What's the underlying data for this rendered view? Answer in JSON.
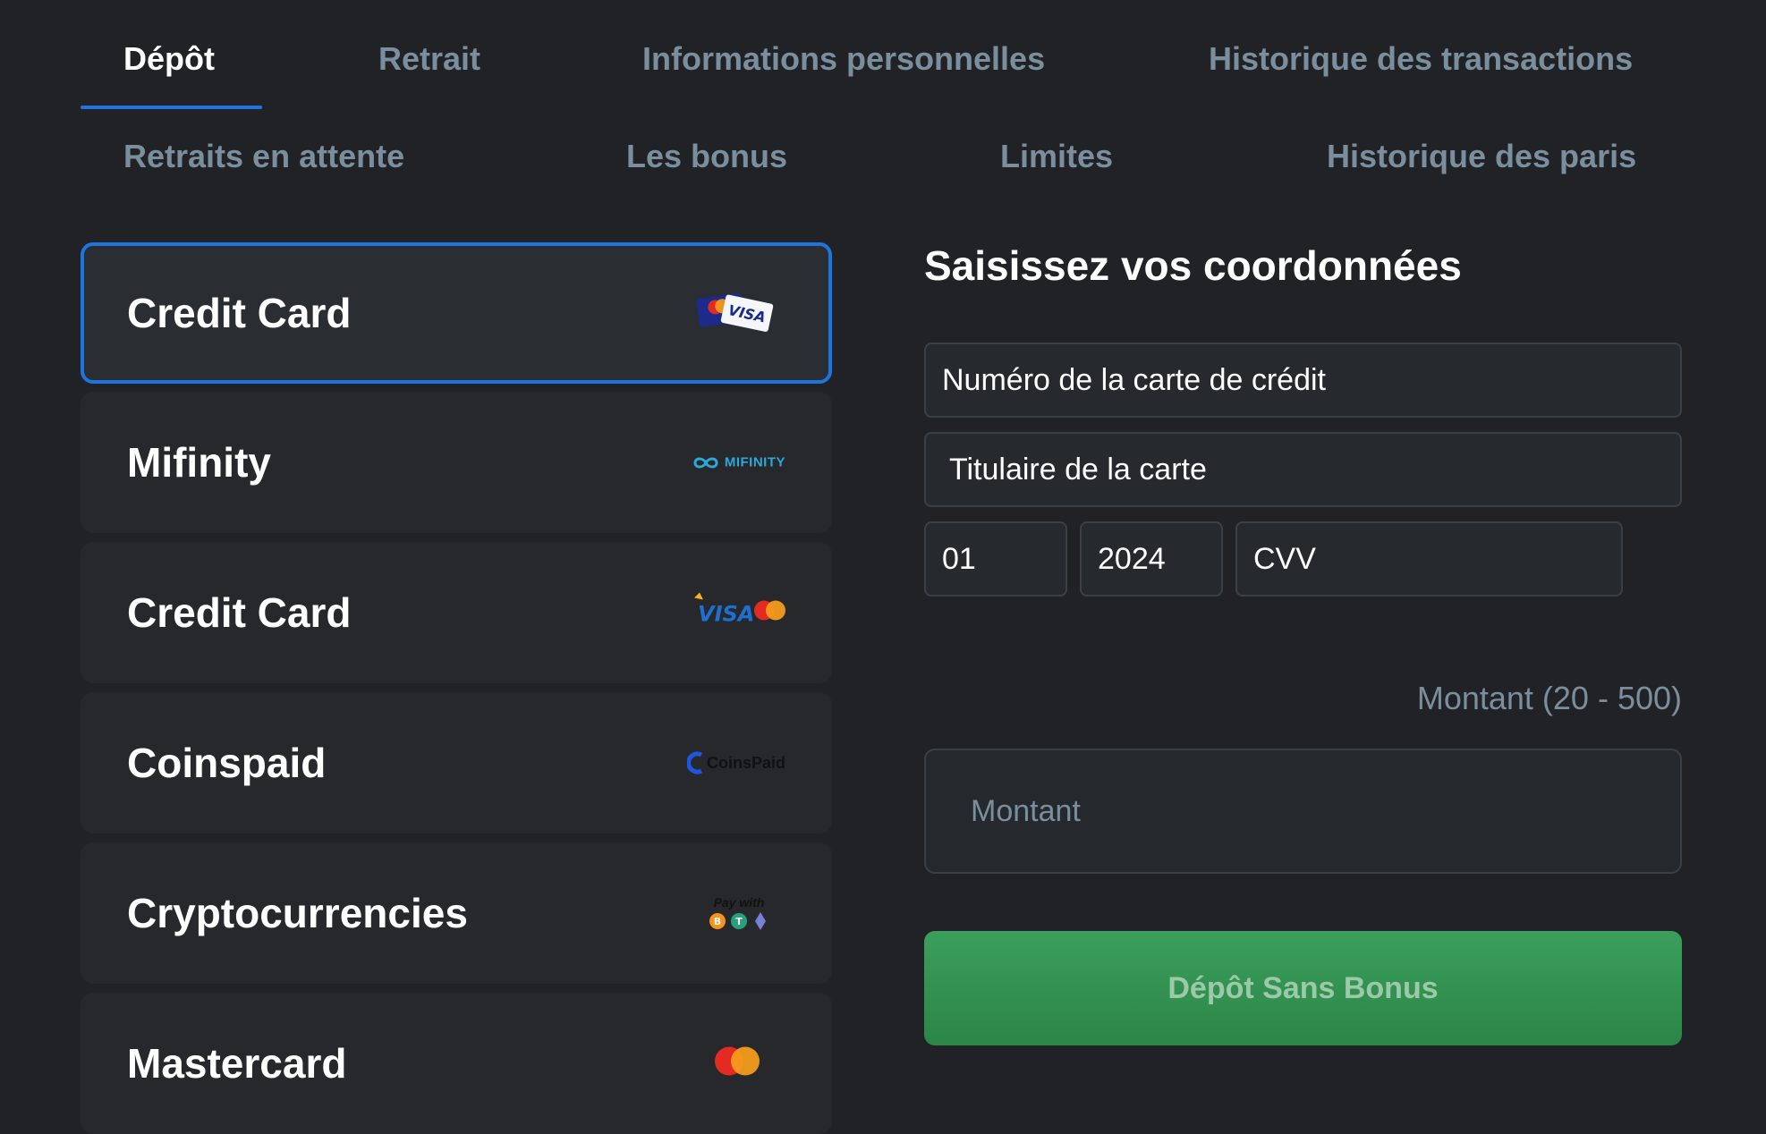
{
  "tabs": [
    {
      "label": "Dépôt",
      "active": true
    },
    {
      "label": "Retrait"
    },
    {
      "label": "Informations personnelles"
    },
    {
      "label": "Historique des transactions"
    },
    {
      "label": "Retraits en attente"
    },
    {
      "label": "Les bonus"
    },
    {
      "label": "Limites"
    },
    {
      "label": "Historique des paris"
    }
  ],
  "methods": [
    {
      "label": "Credit Card",
      "logo": "mastercard-visa-cards-icon",
      "selected": true
    },
    {
      "label": "Mifinity",
      "logo": "mifinity-logo",
      "logo_text": "MIFINITY"
    },
    {
      "label": "Credit Card",
      "logo": "visa-mastercard-logo"
    },
    {
      "label": "Coinspaid",
      "logo": "coinspaid-logo",
      "logo_text": "CoinsPaid"
    },
    {
      "label": "Cryptocurrencies",
      "logo": "pay-with-crypto-logo",
      "logo_text": "Pay with"
    },
    {
      "label": "Mastercard",
      "logo": "mastercard-logo"
    }
  ],
  "form": {
    "title": "Saisissez vos coordonnées",
    "card_number_placeholder": "Numéro de la carte de crédit",
    "card_holder_placeholder": "Titulaire de la carte",
    "expiry_month": "01",
    "expiry_year": "2024",
    "cvv_placeholder": "CVV",
    "amount_range": "Montant (20 - 500)",
    "amount_placeholder": "Montant",
    "submit_label": "Dépôt Sans Bonus"
  },
  "colors": {
    "background": "#202225",
    "accent": "#1f75e0",
    "button": "#2e8a4b",
    "muted_text": "#7b8e9d"
  }
}
